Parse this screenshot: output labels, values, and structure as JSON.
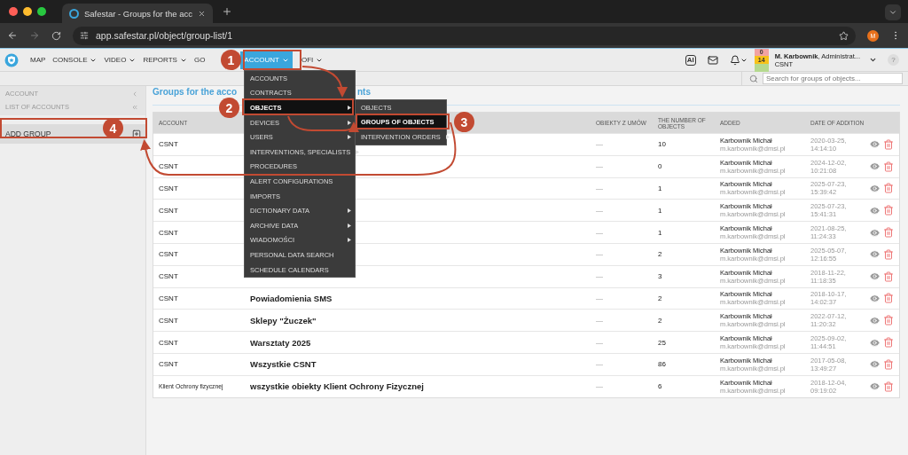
{
  "browser": {
    "tab_title": "Safestar - Groups for the acc",
    "url": "app.safestar.pl/object/group-list/1",
    "profile_initial": "M"
  },
  "nav": {
    "items": [
      {
        "label": "MAP",
        "has_dropdown": false,
        "selected": false
      },
      {
        "label": "CONSOLE",
        "has_dropdown": true,
        "selected": false
      },
      {
        "label": "VIDEO",
        "has_dropdown": true,
        "selected": false
      },
      {
        "label": "REPORTS",
        "has_dropdown": true,
        "selected": false
      },
      {
        "label": "GO",
        "has_dropdown": false,
        "selected": false
      },
      {
        "label": "ACCOUNT",
        "has_dropdown": true,
        "selected": true
      },
      {
        "label": "OFI",
        "has_dropdown": true,
        "selected": false
      }
    ],
    "ai_label": "AI",
    "counters": [
      {
        "value": "0",
        "color": "#f2a3a3"
      },
      {
        "value": "14",
        "color": "#f7c21a"
      },
      {
        "color": "#b5d98f"
      }
    ],
    "user": {
      "name": "**M. Karbownik**, Administrat...",
      "account": "CSNT"
    },
    "help_label": "?"
  },
  "search": {
    "placeholder": "Search for groups of objects..."
  },
  "sidebar": {
    "items": [
      {
        "label": "ACCOUNT",
        "kind": "back"
      },
      {
        "label": "LIST OF ACCOUNTS",
        "kind": "collapse"
      }
    ],
    "action": {
      "label": "ADD GROUP"
    }
  },
  "title": {
    "start": "Groups for the acco",
    "end": "nts"
  },
  "menu": {
    "items": [
      {
        "label": "ACCOUNTS",
        "has_submenu": false,
        "selected": false
      },
      {
        "label": "CONTRACTS",
        "has_submenu": false,
        "selected": false
      },
      {
        "label": "OBJECTS",
        "has_submenu": true,
        "selected": true
      },
      {
        "label": "DEVICES",
        "has_submenu": true,
        "selected": false
      },
      {
        "label": "USERS",
        "has_submenu": true,
        "selected": false
      },
      {
        "label": "INTERVENTIONS, SPECIALISTS",
        "has_submenu": true,
        "selected": false
      },
      {
        "label": "PROCEDURES",
        "has_submenu": false,
        "selected": false
      },
      {
        "label": "ALERT CONFIGURATIONS",
        "has_submenu": false,
        "selected": false
      },
      {
        "label": "IMPORTS",
        "has_submenu": false,
        "selected": false
      },
      {
        "label": "DICTIONARY DATA",
        "has_submenu": true,
        "selected": false
      },
      {
        "label": "ARCHIVE DATA",
        "has_submenu": true,
        "selected": false
      },
      {
        "label": "WIADOMOŚCI",
        "has_submenu": true,
        "selected": false
      },
      {
        "label": "PERSONAL DATA SEARCH",
        "has_submenu": false,
        "selected": false
      },
      {
        "label": "SCHEDULE CALENDARS",
        "has_submenu": false,
        "selected": false
      }
    ],
    "submenu": [
      {
        "label": "OBJECTS",
        "has_submenu": false,
        "selected": false
      },
      {
        "label": "GROUPS OF OBJECTS",
        "has_submenu": false,
        "selected": true
      },
      {
        "label": "INTERVENTION ORDERS",
        "has_submenu": true,
        "selected": false
      }
    ]
  },
  "table": {
    "columns": [
      "ACCOUNT",
      "OBIEKTY Z UMÓW",
      "THE NUMBER OF OBJECTS",
      "ADDED",
      "DATE OF ADDITION"
    ],
    "rows": [
      {
        "account": "CSNT",
        "contract_objects": "—",
        "count": "10",
        "added_by": "Karbownik Michał",
        "email": "m.karbownik@dmsi.pl",
        "date": "2020-03-25,",
        "time": "14:14:10"
      },
      {
        "account": "CSNT",
        "contract_objects": "—",
        "count": "0",
        "added_by": "Karbownik Michał",
        "email": "m.karbownik@dmsi.pl",
        "date": "2024-12-02,",
        "time": "10:21:08"
      },
      {
        "account": "CSNT",
        "contract_objects": "—",
        "count": "1",
        "added_by": "Karbownik Michał",
        "email": "m.karbownik@dmsi.pl",
        "date": "2025-07-23,",
        "time": "15:39:42"
      },
      {
        "account": "CSNT",
        "contract_objects": "—",
        "count": "1",
        "added_by": "Karbownik Michał",
        "email": "m.karbownik@dmsi.pl",
        "date": "2025-07-23,",
        "time": "15:41:31"
      },
      {
        "account": "CSNT",
        "contract_objects": "—",
        "count": "1",
        "added_by": "Karbownik Michał",
        "email": "m.karbownik@dmsi.pl",
        "date": "2021-08-25,",
        "time": "11:24:33"
      },
      {
        "account": "CSNT",
        "contract_objects": "—",
        "count": "2",
        "added_by": "Karbownik Michał",
        "email": "m.karbownik@dmsi.pl",
        "date": "2025-05-07,",
        "time": "12:16:55"
      },
      {
        "account": "CSNT",
        "contract_objects": "—",
        "count": "3",
        "added_by": "Karbownik Michał",
        "email": "m.karbownik@dmsi.pl",
        "date": "2018-11-22,",
        "time": "11:18:35"
      },
      {
        "account": "CSNT",
        "name": "Powiadomienia SMS",
        "contract_objects": "—",
        "count": "2",
        "added_by": "Karbownik Michał",
        "email": "m.karbownik@dmsi.pl",
        "date": "2018-10-17,",
        "time": "14:02:37"
      },
      {
        "account": "CSNT",
        "name": "Sklepy \"Żuczek\"",
        "contract_objects": "—",
        "count": "2",
        "added_by": "Karbownik Michał",
        "email": "m.karbownik@dmsi.pl",
        "date": "2022-07-12,",
        "time": "11:20:32"
      },
      {
        "account": "CSNT",
        "name": "Warsztaty 2025",
        "contract_objects": "—",
        "count": "25",
        "added_by": "Karbownik Michał",
        "email": "m.karbownik@dmsi.pl",
        "date": "2025-09-02,",
        "time": "11:44:51"
      },
      {
        "account": "CSNT",
        "name": "Wszystkie CSNT",
        "contract_objects": "—",
        "count": "86",
        "added_by": "Karbownik Michał",
        "email": "m.karbownik@dmsi.pl",
        "date": "2017-05-08,",
        "time": "13:49:27"
      },
      {
        "account": "Klient Ochrony fizycznej",
        "name": "wszystkie obiekty Klient Ochrony Fizycznej",
        "contract_objects": "—",
        "count": "6",
        "added_by": "Karbownik Michał",
        "email": "m.karbownik@dmsi.pl",
        "date": "2018-12-04,",
        "time": "09:19:02"
      }
    ]
  },
  "annotations": {
    "steps": [
      "1",
      "2",
      "3",
      "4"
    ]
  }
}
